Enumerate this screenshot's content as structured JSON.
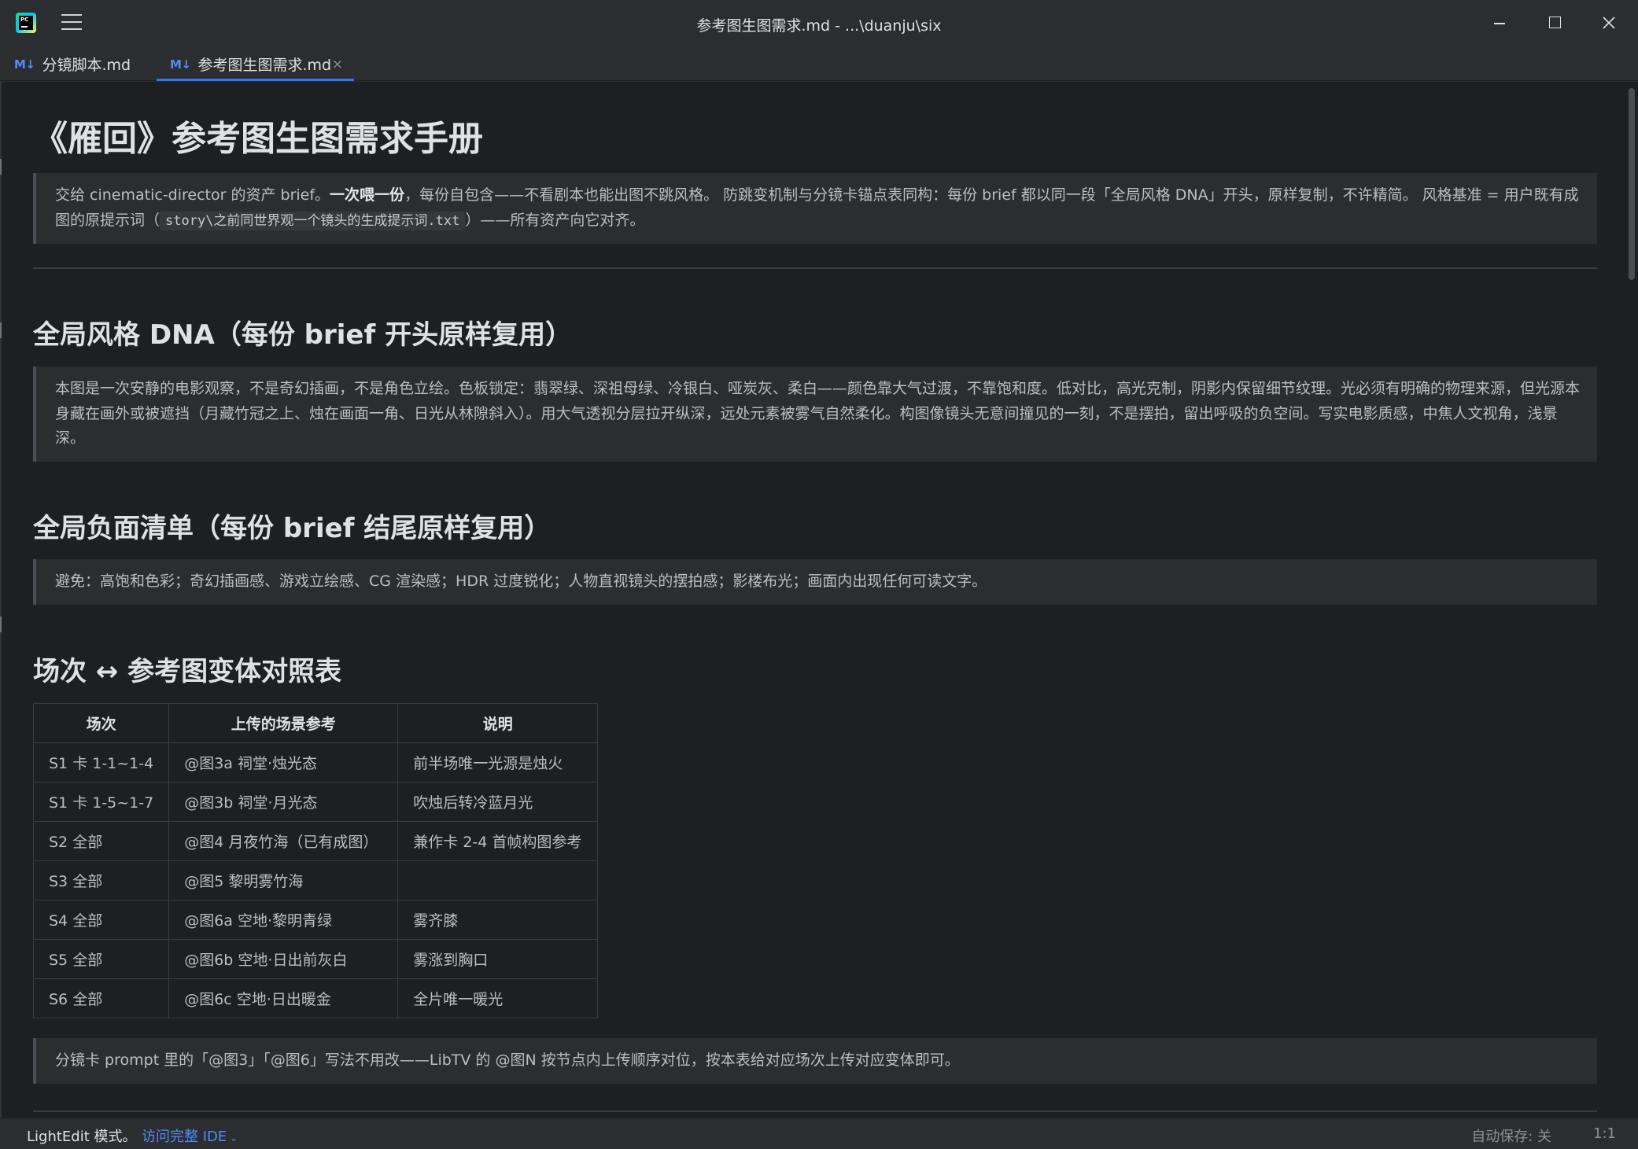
{
  "window": {
    "title": "参考图生图需求.md - ...\\duanju\\six"
  },
  "tabs": [
    {
      "icon": "M↓",
      "label": "分镜脚本.md"
    },
    {
      "icon": "M↓",
      "label": "参考图生图需求.md",
      "close": "×"
    }
  ],
  "doc": {
    "h1": "《雁回》参考图生图需求手册",
    "intro": {
      "p1": "交给 cinematic-director 的资产 brief。",
      "bold": "一次喂一份",
      "p2": "，每份自包含——不看剧本也能出图不跳风格。 防跳变机制与分镜卡锚点表同构：每份 brief 都以同一段「全局风格 DNA」开头，原样复制，不许精简。 风格基准 = 用户既有成图的原提示词（",
      "code": "story\\之前同世界观一个镜头的生成提示词.txt",
      "p3": "）——所有资产向它对齐。"
    },
    "h2_dna": "全局风格 DNA（每份 brief 开头原样复用）",
    "dna_text": "本图是一次安静的电影观察，不是奇幻插画，不是角色立绘。色板锁定：翡翠绿、深祖母绿、冷银白、哑炭灰、柔白——颜色靠大气过渡，不靠饱和度。低对比，高光克制，阴影内保留细节纹理。光必须有明确的物理来源，但光源本身藏在画外或被遮挡（月藏竹冠之上、烛在画面一角、日光从林隙斜入）。用大气透视分层拉开纵深，远处元素被雾气自然柔化。构图像镜头无意间撞见的一刻，不是摆拍，留出呼吸的负空间。写实电影质感，中焦人文视角，浅景深。",
    "h2_neg": "全局负面清单（每份 brief 结尾原样复用）",
    "neg_text": "避免：高饱和色彩；奇幻插画感、游戏立绘感、CG 渲染感；HDR 过度锐化；人物直视镜头的摆拍感；影楼布光；画面内出现任何可读文字。",
    "h2_table": "场次 ↔ 参考图变体对照表",
    "table": {
      "headers": [
        "场次",
        "上传的场景参考",
        "说明"
      ],
      "rows": [
        [
          "S1 卡 1-1~1-4",
          "@图3a 祠堂·烛光态",
          "前半场唯一光源是烛火"
        ],
        [
          "S1 卡 1-5~1-7",
          "@图3b 祠堂·月光态",
          "吹烛后转冷蓝月光"
        ],
        [
          "S2 全部",
          "@图4 月夜竹海（已有成图）",
          "兼作卡 2-4 首帧构图参考"
        ],
        [
          "S3 全部",
          "@图5 黎明雾竹海",
          ""
        ],
        [
          "S4 全部",
          "@图6a 空地·黎明青绿",
          "雾齐膝"
        ],
        [
          "S5 全部",
          "@图6b 空地·日出前灰白",
          "雾涨到胸口"
        ],
        [
          "S6 全部",
          "@图6c 空地·日出暖金",
          "全片唯一暖光"
        ]
      ]
    },
    "note_text": "分镜卡 prompt 里的「@图3」「@图6」写法不用改——LibTV 的 @图N 按节点内上传顺序对位，按本表给对应场次上传对应变体即可。"
  },
  "status": {
    "mode": "LightEdit 模式。",
    "link": "访问完整 IDE",
    "autosave": "自动保存: 关",
    "position": "1:1"
  },
  "colors": {
    "background": "#1e1f22",
    "chrome": "#2b2d30",
    "accent": "#3574f0",
    "link": "#548af7",
    "text": "#dfe1e5"
  }
}
